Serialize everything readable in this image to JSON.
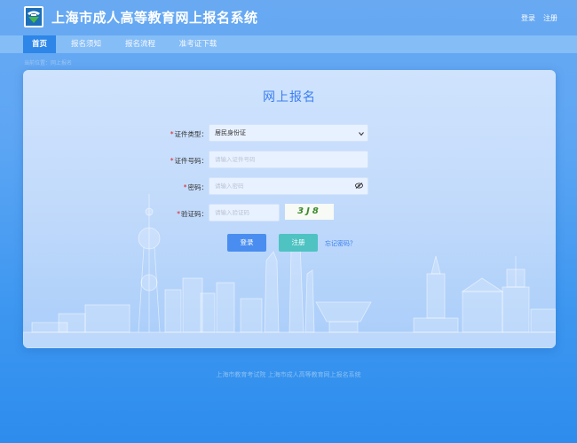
{
  "header": {
    "title": "上海市成人高等教育网上报名系统",
    "logo_icon": "shanghai-education-logo",
    "links": {
      "login": "登录",
      "register": "注册"
    }
  },
  "nav": {
    "items": [
      {
        "label": "首页",
        "active": true
      },
      {
        "label": "报名须知",
        "active": false
      },
      {
        "label": "报名流程",
        "active": false
      },
      {
        "label": "准考证下载",
        "active": false
      }
    ]
  },
  "breadcrumb": "当前位置：网上报名",
  "form": {
    "title": "网上报名",
    "id_type": {
      "label": "证件类型：",
      "value": "居民身份证"
    },
    "id_number": {
      "label": "证件号码：",
      "placeholder": "请输入证件号码",
      "value": ""
    },
    "password": {
      "label": "密码：",
      "placeholder": "请输入密码",
      "value": "",
      "toggle_icon": "eye-icon"
    },
    "captcha": {
      "label": "验证码：",
      "placeholder": "请输入验证码",
      "value": "",
      "image_text": "3J8"
    },
    "buttons": {
      "login": "登录",
      "register": "注册"
    },
    "forgot": "忘记密码？"
  },
  "footer": "上海市教育考试院    上海市成人高等教育网上报名系统",
  "colors": {
    "accent": "#3b7ff0",
    "login_button": "#4a8df0",
    "register_button": "#4ec3c2",
    "nav_active": "#2d86e8",
    "required_star": "#e02020"
  }
}
